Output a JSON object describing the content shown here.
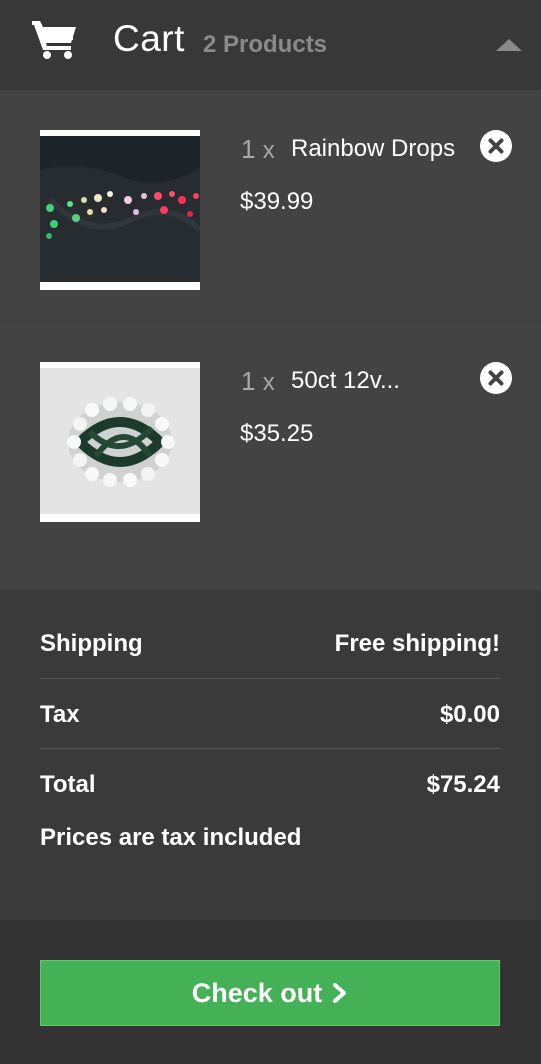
{
  "header": {
    "title": "Cart",
    "count_label": "2 Products",
    "icons": {
      "cart": "cart-icon",
      "collapse": "caret-up-icon"
    }
  },
  "items": [
    {
      "quantity": "1",
      "multiplier": "x",
      "name": "Rainbow Drops",
      "price": "$39.99",
      "image": "rainbow-drops-lights-photo",
      "remove_icon": "close-circle-icon"
    },
    {
      "quantity": "1",
      "multiplier": "x",
      "name": "50ct 12v...",
      "price": "$35.25",
      "image": "white-bulb-string-photo",
      "remove_icon": "close-circle-icon"
    }
  ],
  "summary": {
    "shipping_label": "Shipping",
    "shipping_value": "Free shipping!",
    "tax_label": "Tax",
    "tax_value": "$0.00",
    "total_label": "Total",
    "total_value": "$75.24",
    "tax_note": "Prices are tax included"
  },
  "checkout": {
    "label": "Check out",
    "icon": "chevron-right-icon"
  },
  "colors": {
    "background": "#383838",
    "item_background": "#434343",
    "accent_green": "#44b157",
    "muted_text": "#8a8a8a"
  }
}
